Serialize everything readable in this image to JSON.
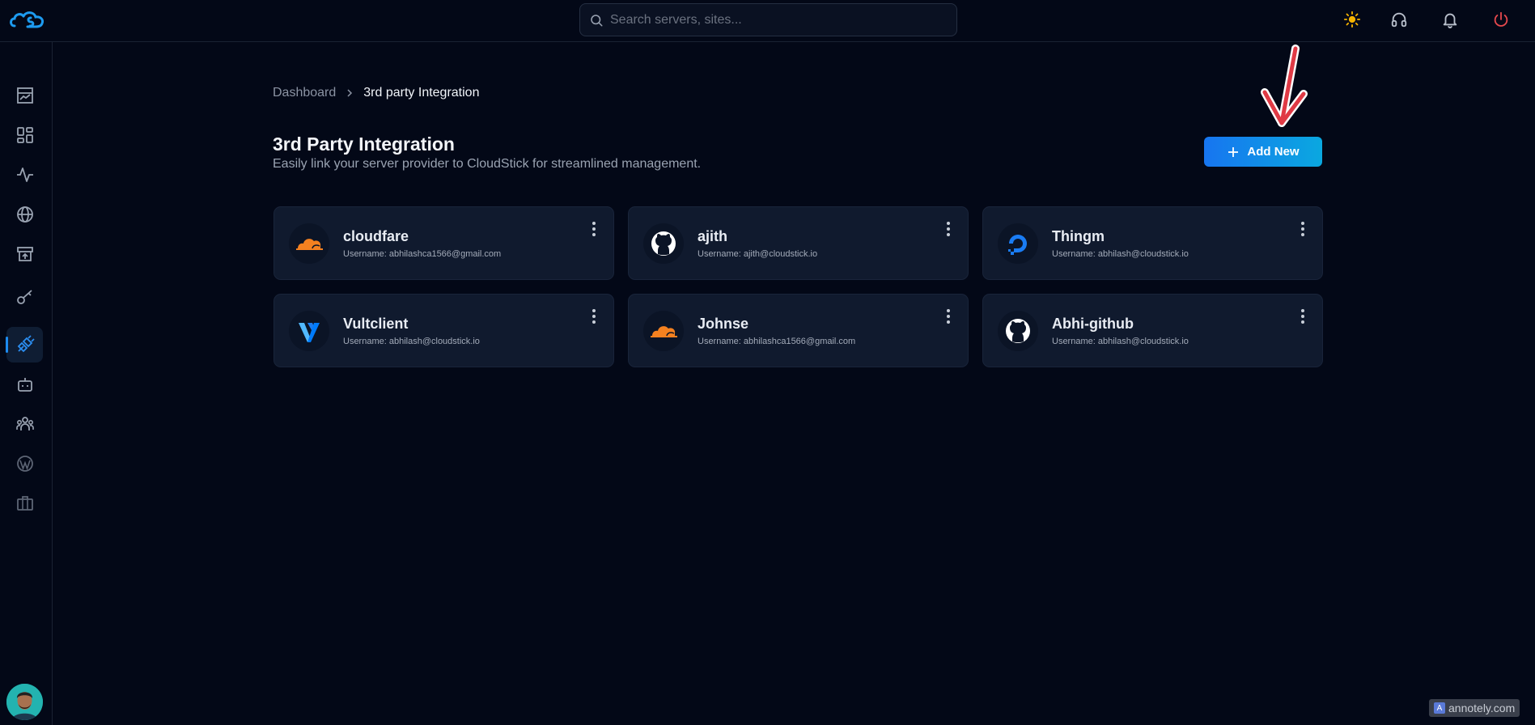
{
  "header": {
    "search_placeholder": "Search servers, sites..."
  },
  "sidebar": {
    "items": [
      {
        "icon": "dashboard-chart-icon"
      },
      {
        "icon": "apps-grid-icon"
      },
      {
        "icon": "activity-icon"
      },
      {
        "icon": "globe-icon"
      },
      {
        "icon": "archive-upload-icon"
      },
      {
        "icon": "key-icon"
      },
      {
        "icon": "plug-icon",
        "active": true
      },
      {
        "icon": "bot-icon"
      },
      {
        "icon": "team-icon"
      },
      {
        "icon": "wordpress-icon"
      },
      {
        "icon": "briefcase-icon"
      }
    ]
  },
  "breadcrumb": {
    "root": "Dashboard",
    "current": "3rd party Integration"
  },
  "page": {
    "title": "3rd Party Integration",
    "subtitle": "Easily link your server provider to CloudStick for streamlined management.",
    "add_button": "Add New"
  },
  "integrations": [
    {
      "name": "cloudfare",
      "username": "Username: abhilashca1566@gmail.com",
      "provider": "cloudflare"
    },
    {
      "name": "ajith",
      "username": "Username: ajith@cloudstick.io",
      "provider": "github"
    },
    {
      "name": "Thingm",
      "username": "Username: abhilash@cloudstick.io",
      "provider": "digitalocean"
    },
    {
      "name": "Vultclient",
      "username": "Username: abhilash@cloudstick.io",
      "provider": "vultr"
    },
    {
      "name": "Johnse",
      "username": "Username: abhilashca1566@gmail.com",
      "provider": "cloudflare"
    },
    {
      "name": "Abhi-github",
      "username": "Username: abhilash@cloudstick.io",
      "provider": "github"
    }
  ],
  "watermark": "annotely.com",
  "colors": {
    "background": "#030817",
    "card": "#101a2e",
    "accent": "#1775f0",
    "cloudflare": "#f48120",
    "annotation_arrow": "#e03a45",
    "power": "#e5484d",
    "sun": "#f5b301"
  }
}
